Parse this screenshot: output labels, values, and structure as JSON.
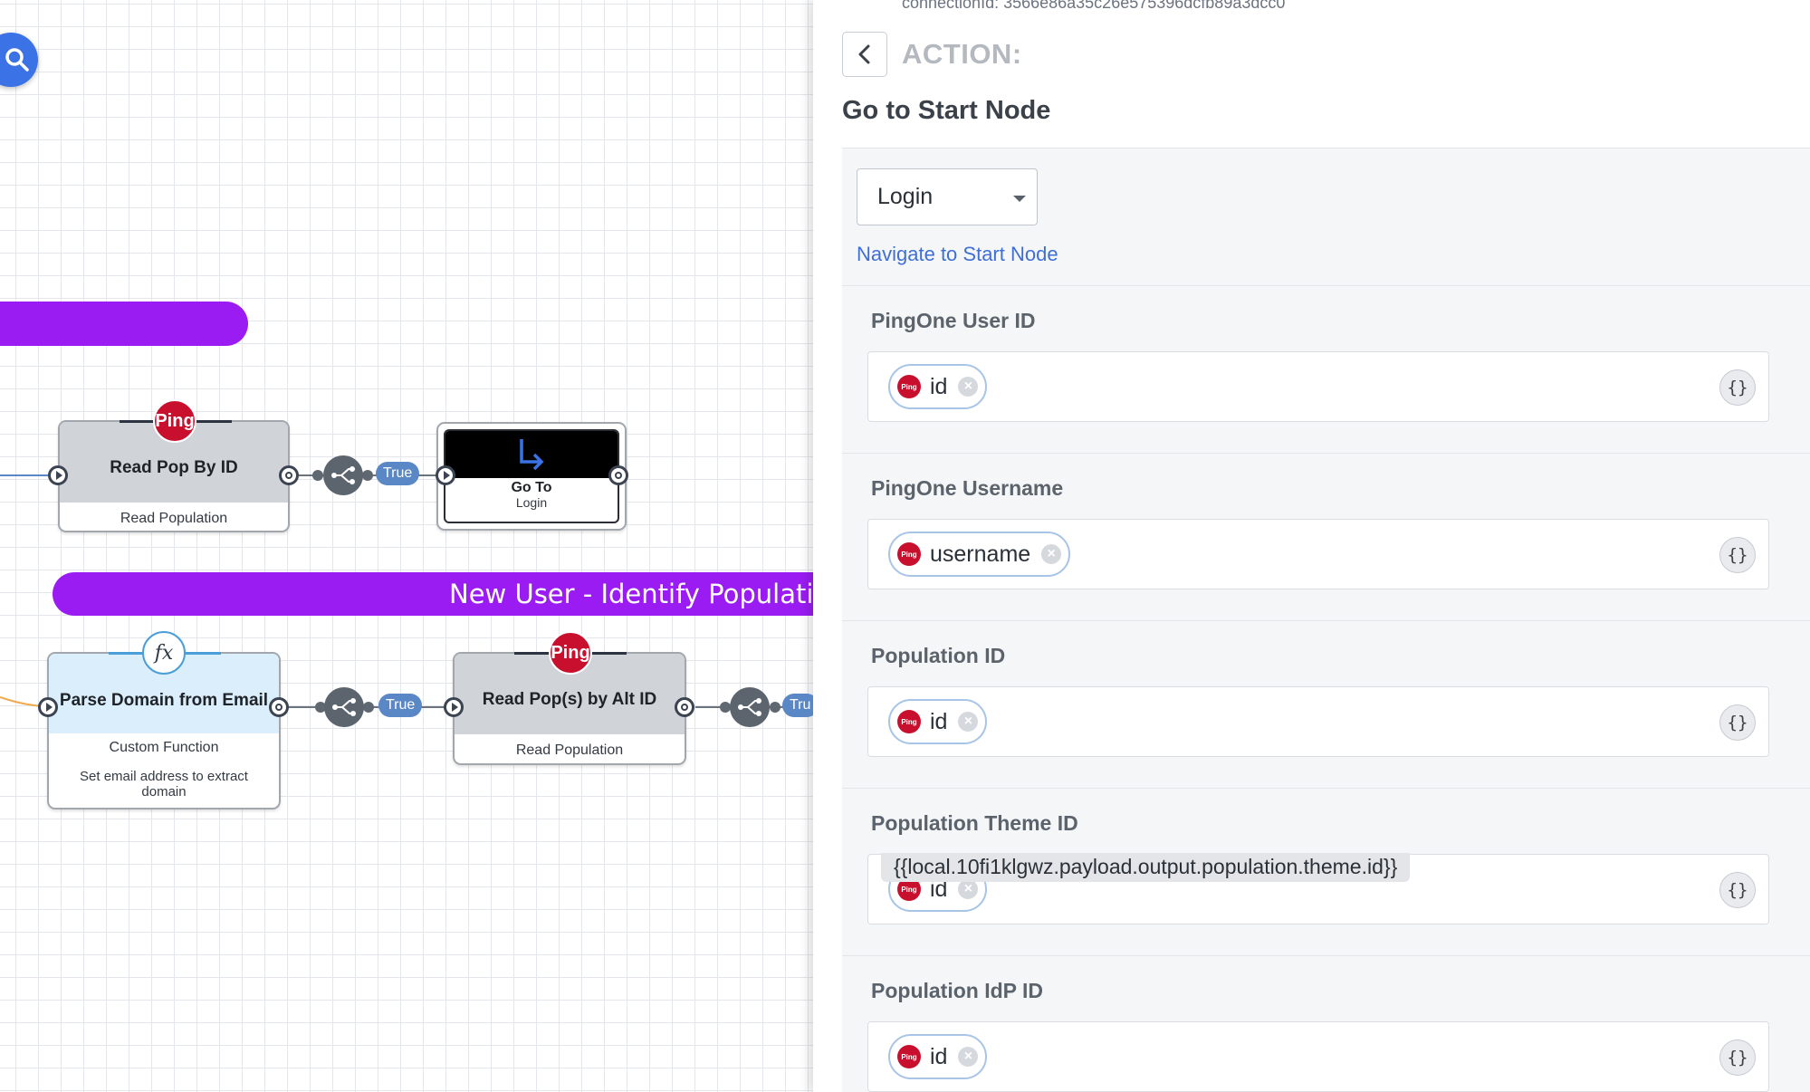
{
  "canvas": {
    "group_bar_1": {
      "label": ""
    },
    "group_bar_2": {
      "label": "New User - Identify Populati"
    },
    "nodes": {
      "read_pop_by_id": {
        "badge": "Ping",
        "title": "Read Pop By ID",
        "subtitle": "Read Population"
      },
      "goto": {
        "title": "Go To",
        "subtitle": "Login"
      },
      "parse_domain": {
        "title": "Parse Domain from Email",
        "subtitle": "Custom Function",
        "description": "Set email address to extract domain"
      },
      "read_pops_alt": {
        "badge": "Ping",
        "title": "Read Pop(s) by Alt ID",
        "subtitle": "Read Population"
      }
    },
    "true_labels": [
      "True",
      "True",
      "Tru"
    ]
  },
  "panel": {
    "connection_id": "connectionId: 3566e86a35c26e575396dcfb89a3dcc0",
    "action_label": "ACTION:",
    "action_title": "Go to Start Node",
    "start_node_select": {
      "value": "Login"
    },
    "navigate_link": "Navigate to Start Node",
    "fields": [
      {
        "label": "PingOne User ID",
        "chip": "id"
      },
      {
        "label": "PingOne Username",
        "chip": "username"
      },
      {
        "label": "Population ID",
        "chip": "id"
      },
      {
        "label": "Population Theme ID",
        "chip": "id",
        "tooltip": "{{local.10fi1klgwz.payload.output.population.theme.id}}"
      },
      {
        "label": "Population IdP ID",
        "chip": "id"
      }
    ],
    "chip_logo_text": "Ping",
    "variable_button": "{}"
  },
  "colors": {
    "group_bar": "#9a1cf2",
    "ping_red": "#c8102e",
    "link_blue": "#3f6fd6",
    "true_pill": "#5a87c6",
    "search_fab": "#3b73e6"
  },
  "icons": [
    "search-icon",
    "branch-icon",
    "goto-arrow-icon",
    "function-icon",
    "chevron-left-icon",
    "caret-down-icon",
    "close-icon",
    "braces-icon"
  ]
}
